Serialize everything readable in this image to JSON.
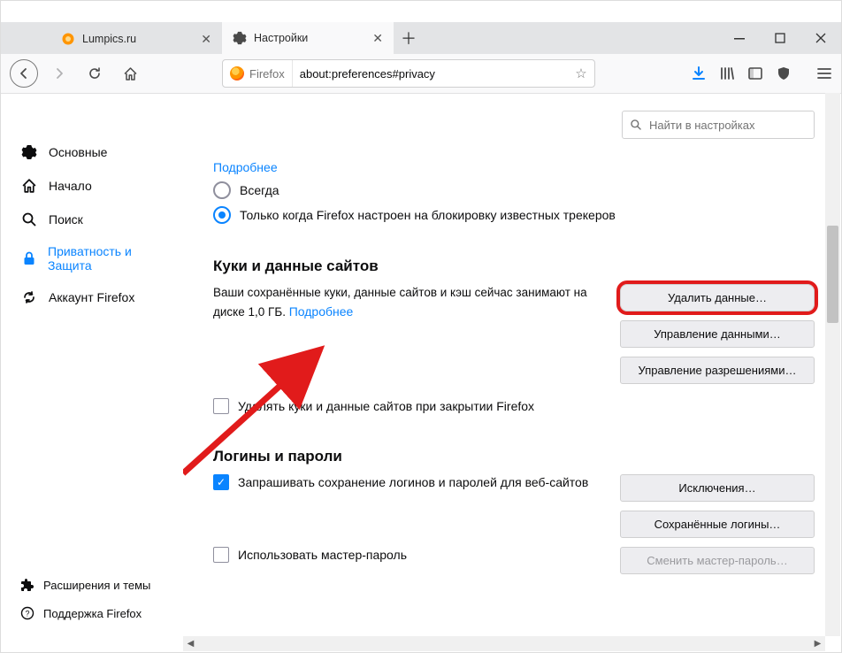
{
  "tabs": {
    "inactive": {
      "label": "Lumpics.ru"
    },
    "active": {
      "label": "Настройки"
    }
  },
  "url": {
    "identity": "Firefox",
    "value": "about:preferences#privacy"
  },
  "search": {
    "placeholder": "Найти в настройках"
  },
  "sidebar": {
    "items": [
      {
        "label": "Основные"
      },
      {
        "label": "Начало"
      },
      {
        "label": "Поиск"
      },
      {
        "label": "Приватность и Защита"
      },
      {
        "label": "Аккаунт Firefox"
      }
    ],
    "footer": [
      {
        "label": "Расширения и темы"
      },
      {
        "label": "Поддержка Firefox"
      }
    ]
  },
  "content_protection": {
    "more": "Подробнее",
    "radio_always": "Всегда",
    "radio_only_trackers": "Только когда Firefox настроен на блокировку известных трекеров"
  },
  "cookies": {
    "heading": "Куки и данные сайтов",
    "body_prefix": "Ваши сохранённые куки, данные сайтов и кэш сейчас занимают на диске ",
    "size": "1,0 ГБ",
    "body_suffix": ".   ",
    "more": "Подробнее",
    "delete_btn": "Удалить данные…",
    "manage_btn": "Управление данными…",
    "perms_btn": "Управление разрешениями…",
    "checkbox_clear_on_close": "Удалять куки и данные сайтов при закрытии Firefox"
  },
  "logins": {
    "heading": "Логины и пароли",
    "checkbox_ask_save": "Запрашивать сохранение логинов и паролей для веб-сайтов",
    "exceptions_btn": "Исключения…",
    "saved_btn": "Сохранённые логины…",
    "checkbox_master": "Использовать мастер-пароль",
    "change_master_btn": "Сменить мастер-пароль…"
  }
}
